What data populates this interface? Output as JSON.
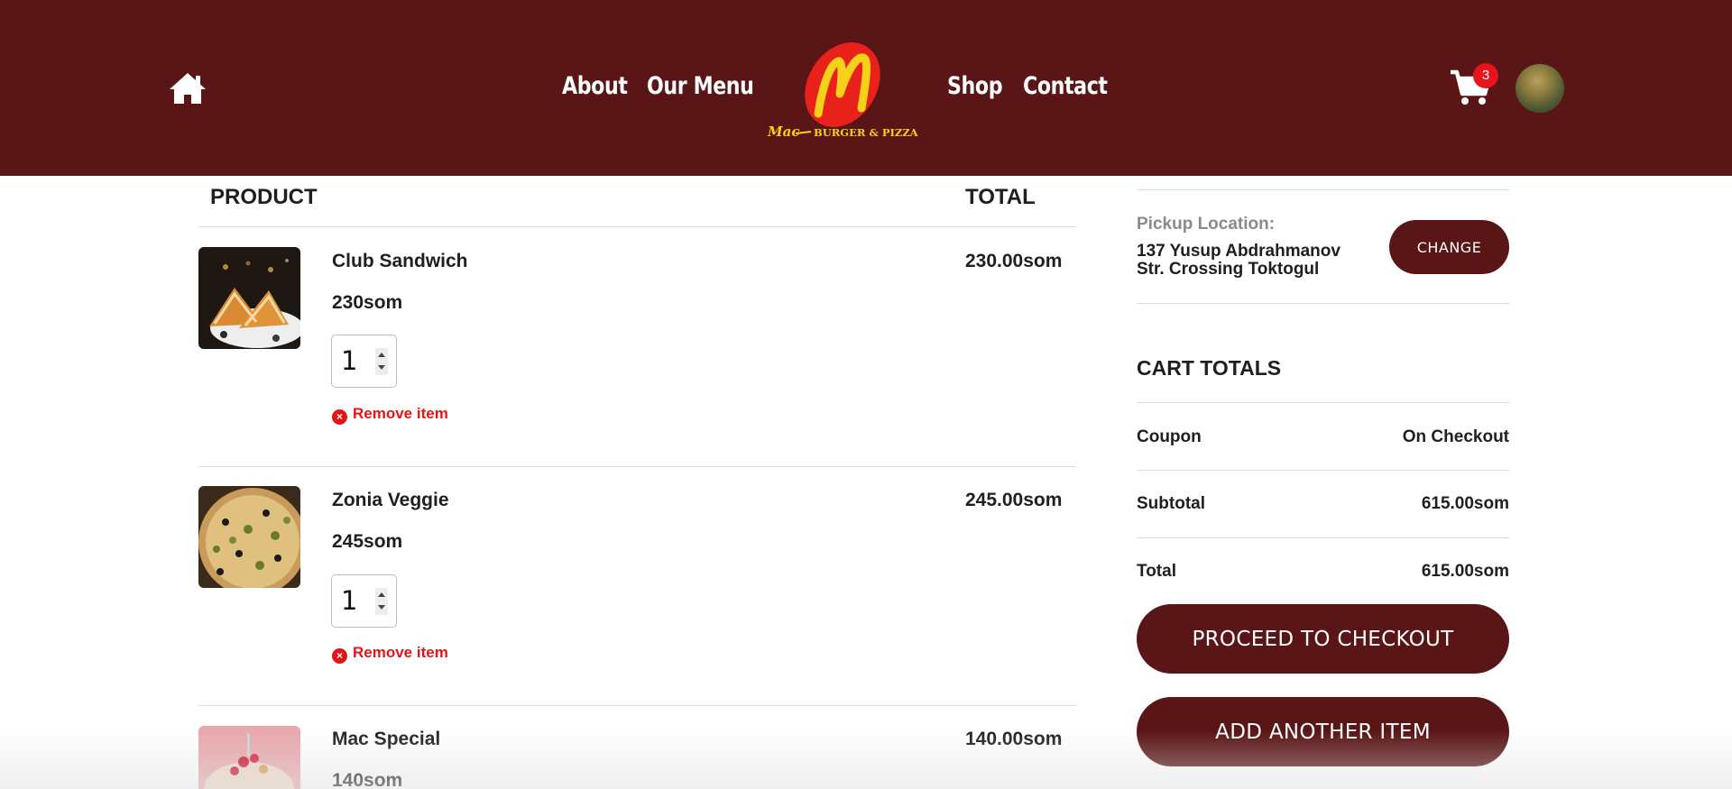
{
  "header": {
    "nav_left": [
      "About",
      "Our Menu"
    ],
    "nav_right": [
      "Shop",
      "Contact"
    ],
    "logo": {
      "script": "Mac",
      "subtitle": "BURGER & PIZZA",
      "letter": "M"
    },
    "cart_count": "3",
    "colors": {
      "brand": "#5a1516",
      "logo_red": "#e8221b",
      "logo_yellow": "#f5d21a",
      "badge": "#e8141b"
    }
  },
  "table": {
    "headers": {
      "product": "PRODUCT",
      "total": "TOTAL"
    },
    "items": [
      {
        "name": "Club Sandwich",
        "price": "230som",
        "total": "230.00som",
        "qty": "1",
        "remove": "Remove item"
      },
      {
        "name": "Zonia Veggie",
        "price": "245som",
        "total": "245.00som",
        "qty": "1",
        "remove": "Remove item"
      },
      {
        "name": "Mac Special",
        "price": "140som",
        "total": "140.00som"
      }
    ]
  },
  "sidebar": {
    "pickup_label": "Pickup Location:",
    "pickup_address": "137 Yusup Abdrahmanov Str. Crossing Toktogul",
    "change_button": "CHANGE",
    "totals_title": "CART TOTALS",
    "rows": [
      {
        "label": "Coupon",
        "value": "On Checkout"
      },
      {
        "label": "Subtotal",
        "value": "615.00som"
      },
      {
        "label": "Total",
        "value": "615.00som"
      }
    ],
    "checkout_button": "PROCEED TO CHECKOUT",
    "add_item_button": "ADD ANOTHER ITEM"
  }
}
